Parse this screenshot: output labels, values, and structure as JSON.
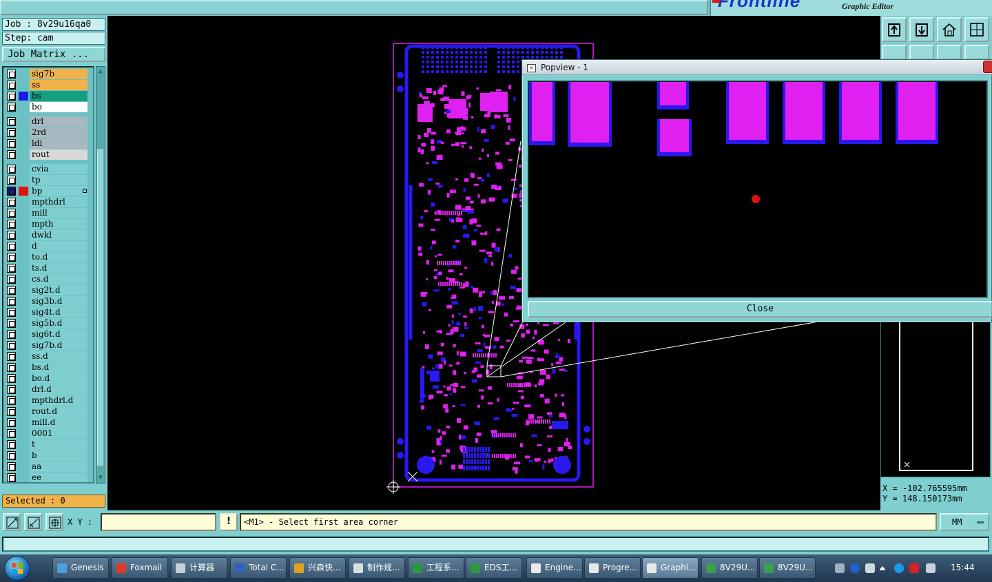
{
  "app": {
    "brand": "Frontline",
    "brand_sub": "Graphic Editor"
  },
  "job": {
    "job_line": "Job : 8v29u16qa0",
    "step_line": "Step: cam",
    "job_matrix_label": "Job Matrix ..."
  },
  "layers": [
    {
      "name": "sig7b",
      "color": "#f2b24a",
      "swatch": ""
    },
    {
      "name": "ss",
      "color": "#f2b24a",
      "swatch": ""
    },
    {
      "name": "bs",
      "color": "#14a080",
      "swatch": "#1a1ae6"
    },
    {
      "name": "bo",
      "color": "#ffffff",
      "swatch": ""
    },
    {
      "name": "drl",
      "color": "#a8b8c0",
      "swatch": ""
    },
    {
      "name": "2rd",
      "color": "#a8b8c0",
      "swatch": ""
    },
    {
      "name": "ldi",
      "color": "#a8b8c0",
      "swatch": ""
    },
    {
      "name": "rout",
      "color": "#d8d8d8",
      "swatch": ""
    },
    {
      "name": "cvia",
      "color": "#7fcfd0",
      "swatch": ""
    },
    {
      "name": "tp",
      "color": "#7fcfd0",
      "swatch": ""
    },
    {
      "name": "bp",
      "color": "#7fcfd0",
      "swatch": "#e01010"
    },
    {
      "name": "mpthdrl",
      "color": "#7fcfd0",
      "swatch": ""
    },
    {
      "name": "mill",
      "color": "#7fcfd0",
      "swatch": ""
    },
    {
      "name": "mpth",
      "color": "#7fcfd0",
      "swatch": ""
    },
    {
      "name": "dwkl",
      "color": "#7fcfd0",
      "swatch": ""
    },
    {
      "name": "d",
      "color": "#7fcfd0",
      "swatch": ""
    },
    {
      "name": "to.d",
      "color": "#7fcfd0",
      "swatch": ""
    },
    {
      "name": "ts.d",
      "color": "#7fcfd0",
      "swatch": ""
    },
    {
      "name": "cs.d",
      "color": "#7fcfd0",
      "swatch": ""
    },
    {
      "name": "sig2t.d",
      "color": "#7fcfd0",
      "swatch": ""
    },
    {
      "name": "sig3b.d",
      "color": "#7fcfd0",
      "swatch": ""
    },
    {
      "name": "sig4t.d",
      "color": "#7fcfd0",
      "swatch": ""
    },
    {
      "name": "sig5b.d",
      "color": "#7fcfd0",
      "swatch": ""
    },
    {
      "name": "sig6t.d",
      "color": "#7fcfd0",
      "swatch": ""
    },
    {
      "name": "sig7b.d",
      "color": "#7fcfd0",
      "swatch": ""
    },
    {
      "name": "ss.d",
      "color": "#7fcfd0",
      "swatch": ""
    },
    {
      "name": "bs.d",
      "color": "#7fcfd0",
      "swatch": ""
    },
    {
      "name": "bo.d",
      "color": "#7fcfd0",
      "swatch": ""
    },
    {
      "name": "drl.d",
      "color": "#7fcfd0",
      "swatch": ""
    },
    {
      "name": "mpthdrl.d",
      "color": "#7fcfd0",
      "swatch": ""
    },
    {
      "name": "rout.d",
      "color": "#7fcfd0",
      "swatch": ""
    },
    {
      "name": "mill.d",
      "color": "#7fcfd0",
      "swatch": ""
    },
    {
      "name": "0001",
      "color": "#7fcfd0",
      "swatch": ""
    },
    {
      "name": "t",
      "color": "#7fcfd0",
      "swatch": ""
    },
    {
      "name": "b",
      "color": "#7fcfd0",
      "swatch": ""
    },
    {
      "name": "aa",
      "color": "#7fcfd0",
      "swatch": ""
    },
    {
      "name": "ee",
      "color": "#7fcfd0",
      "swatch": ""
    }
  ],
  "selected_label": "Selected : 0",
  "popview": {
    "title": "Popview - 1",
    "close_label": "Close"
  },
  "coords": {
    "x_line": "X = -102.765595mm",
    "y_line": "Y = 148.150173mm"
  },
  "command": {
    "xy_label": "X Y :",
    "xy_value": "",
    "warn_label": "!",
    "prompt": "<M1> - Select first area corner",
    "units": "MM"
  },
  "taskbar": {
    "items": [
      {
        "label": "Genesis",
        "icon_color": "#4aa0e0"
      },
      {
        "label": "Foxmail",
        "icon_color": "#e03a2a"
      },
      {
        "label": "计算器",
        "icon_color": "#c8d0d8"
      },
      {
        "label": "Total C...",
        "icon_color": "#3060c0"
      },
      {
        "label": "兴森快...",
        "icon_color": "#e0a020"
      },
      {
        "label": "制作规...",
        "icon_color": "#d8dde2"
      },
      {
        "label": "工程系...",
        "icon_color": "#2a9a40"
      },
      {
        "label": "EDS工...",
        "icon_color": "#2a9a40"
      },
      {
        "label": "Engine...",
        "icon_color": "#e8e8e8"
      },
      {
        "label": "Progre...",
        "icon_color": "#e8e8e8"
      },
      {
        "label": "Graphi...",
        "icon_color": "#e8e8e8"
      },
      {
        "label": "8V29U...",
        "icon_color": "#3aa050"
      },
      {
        "label": "8V29U...",
        "icon_color": "#3aa050"
      }
    ],
    "clock": "15:44"
  },
  "colors": {
    "panel": "#7fcfd0",
    "pad_magenta": "#e020f0",
    "pad_blue": "#2a18f0",
    "selection_dot": "#e01010"
  }
}
